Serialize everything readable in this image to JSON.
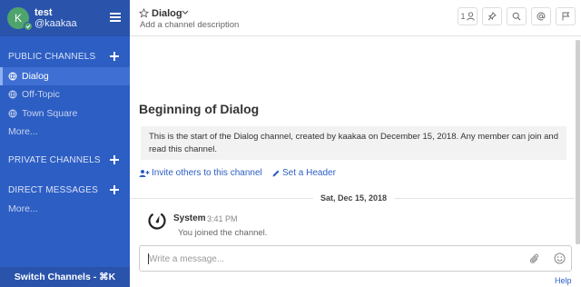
{
  "sidebar": {
    "avatar_letter": "K",
    "team_name": "test",
    "user_name": "@kaakaa",
    "public_title": "PUBLIC CHANNELS",
    "public_channels": [
      {
        "label": "Dialog"
      },
      {
        "label": "Off-Topic"
      },
      {
        "label": "Town Square"
      }
    ],
    "public_more": "More...",
    "private_title": "PRIVATE CHANNELS",
    "direct_title": "DIRECT MESSAGES",
    "direct_more": "More...",
    "switch_label": "Switch Channels - ⌘K"
  },
  "header": {
    "channel_name": "Dialog",
    "description": "Add a channel description",
    "member_count": "1"
  },
  "intro": {
    "title": "Beginning of Dialog",
    "text": "This is the start of the Dialog channel, created by kaakaa on December 15, 2018. Any member can join and read this channel.",
    "invite_label": "Invite others to this channel",
    "header_label": "Set a Header"
  },
  "date_separator": "Sat, Dec 15, 2018",
  "message": {
    "author": "System",
    "time": "3:41 PM",
    "text": "You joined the channel."
  },
  "input": {
    "placeholder": "Write a message..."
  },
  "help_label": "Help",
  "colors": {
    "sidebar": "#2d5ec4",
    "sidebar_header": "#2a53ab",
    "link": "#2d5ec4",
    "online": "#4fa46e"
  }
}
